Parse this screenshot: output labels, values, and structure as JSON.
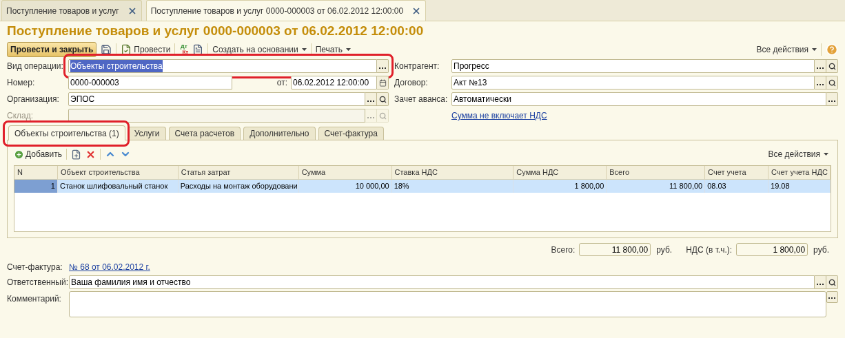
{
  "doc_tabs": [
    {
      "label": "Поступление товаров и услуг",
      "selected": false
    },
    {
      "label": "Поступление товаров и услуг 0000-000003 от 06.02.2012 12:00:00",
      "selected": true
    }
  ],
  "title": "Поступление товаров и услуг 0000-000003 от 06.02.2012 12:00:00",
  "toolbar": {
    "post_close": "Провести и закрыть",
    "post": "Провести",
    "dt": "Дт",
    "kt": "Кт",
    "create_based": "Создать на основании",
    "print": "Печать",
    "all_actions": "Все действия"
  },
  "fields_left": [
    {
      "label": "Вид операции:",
      "value": "Объекты строительства",
      "kind": "select",
      "selected": true,
      "disabled": false,
      "annotated": true
    },
    {
      "label": "Номер:",
      "value": "0000-000003",
      "kind": "number",
      "selected": false,
      "disabled": false,
      "date_label": "от:",
      "date_value": "06.02.2012 12:00:00"
    },
    {
      "label": "Организация:",
      "value": "ЭПОС",
      "kind": "ref",
      "selected": false,
      "disabled": false
    },
    {
      "label": "Склад:",
      "kind": "ref",
      "selected": false,
      "disabled": true
    }
  ],
  "fields_right": [
    {
      "label": "Контрагент:",
      "value": "Прогресс",
      "kind": "ref"
    },
    {
      "label": "Договор:",
      "value": "Акт №13",
      "kind": "ref"
    },
    {
      "label": "Зачет аванса:",
      "value": "Автоматически",
      "kind": "select"
    }
  ],
  "vat_link": "Сумма не включает НДС",
  "tabs": [
    {
      "label": "Объекты строительства (1)",
      "selected": true,
      "annotated": true
    },
    {
      "label": "Услуги",
      "selected": false,
      "annotated": false
    },
    {
      "label": "Счета расчетов",
      "selected": false,
      "annotated": false
    },
    {
      "label": "Дополнительно",
      "selected": false,
      "annotated": false
    },
    {
      "label": "Счет-фактура",
      "selected": false,
      "annotated": false
    }
  ],
  "table_toolbar": {
    "add": "Добавить",
    "all_actions": "Все действия"
  },
  "table": {
    "columns": [
      "N",
      "Объект строительства",
      "Статья затрат",
      "Сумма",
      "Ставка НДС",
      "Сумма НДС",
      "Всего",
      "Счет учета",
      "Счет учета НДС"
    ],
    "rows": [
      {
        "selected": true,
        "cells": [
          "1",
          "Станок шлифовальный станок",
          "Расходы на монтаж оборудовани",
          "10 000,00",
          "18%",
          "1 800,00",
          "11 800,00",
          "08.03",
          "19.08"
        ]
      }
    ]
  },
  "totals": [
    {
      "label": "Всего:",
      "value": "11 800,00",
      "unit": "руб."
    },
    {
      "label": "НДС (в т.ч.):",
      "value": "1 800,00",
      "unit": "руб."
    }
  ],
  "invoice": {
    "label": "Счет-фактура:",
    "link": "№ 68 от 06.02.2012 г."
  },
  "responsible": {
    "label": "Ответственный:",
    "value": "Ваша фамилия имя и отчество"
  },
  "comment": {
    "label": "Комментарий:"
  }
}
